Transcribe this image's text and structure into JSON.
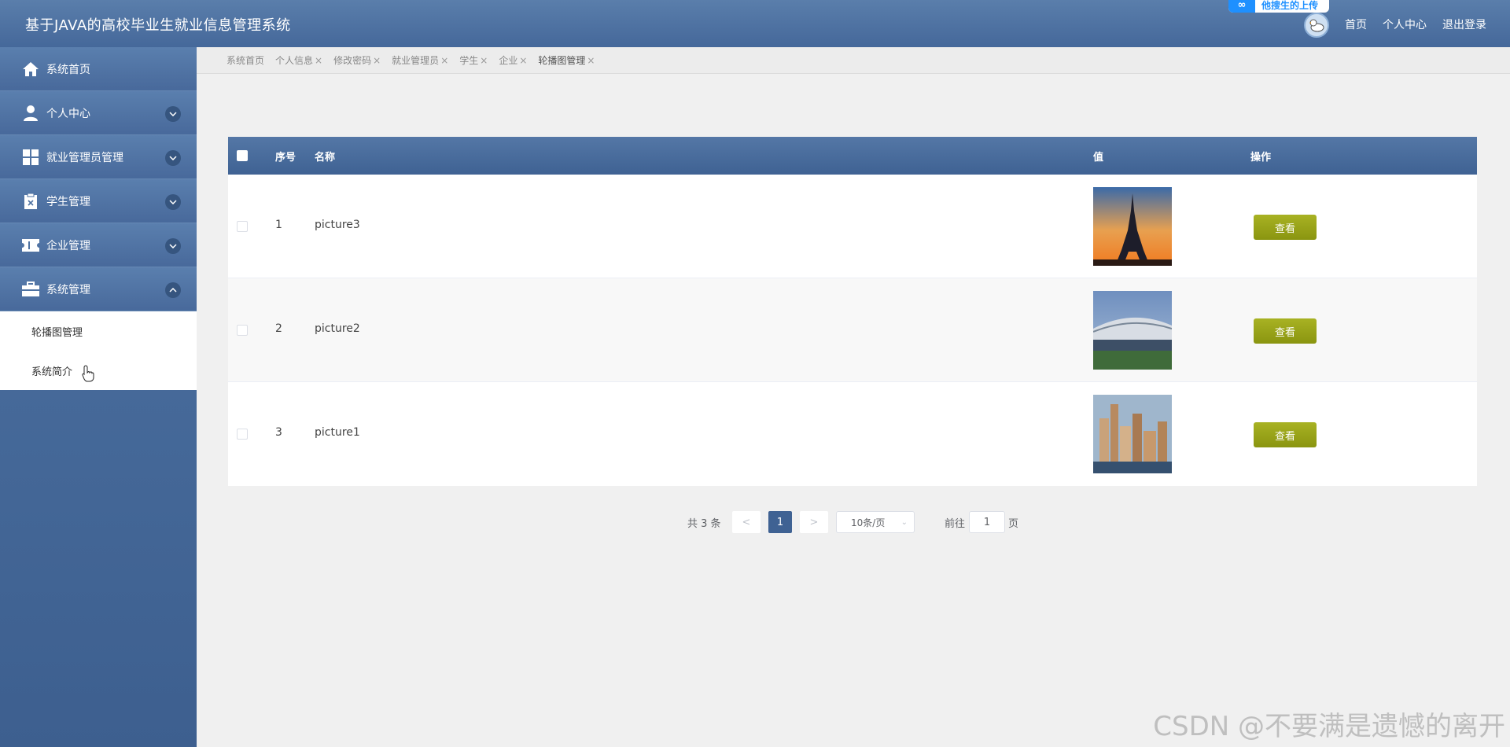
{
  "header": {
    "title": "基于JAVA的高校毕业生就业信息管理系统",
    "upload_badge": "他搜生的上传",
    "nav": [
      "首页",
      "个人中心",
      "退出登录"
    ]
  },
  "sidebar": {
    "items": [
      {
        "label": "系统首页",
        "icon": "home-icon"
      },
      {
        "label": "个人中心",
        "icon": "user-icon"
      },
      {
        "label": "就业管理员管理",
        "icon": "grid-icon"
      },
      {
        "label": "学生管理",
        "icon": "clipboard-icon"
      },
      {
        "label": "企业管理",
        "icon": "ticket-icon"
      },
      {
        "label": "系统管理",
        "icon": "briefcase-icon"
      }
    ],
    "submenu": [
      "轮播图管理",
      "系统简介"
    ]
  },
  "tabs": [
    {
      "label": "系统首页",
      "closable": false
    },
    {
      "label": "个人信息",
      "closable": true
    },
    {
      "label": "修改密码",
      "closable": true
    },
    {
      "label": "就业管理员",
      "closable": true
    },
    {
      "label": "学生",
      "closable": true
    },
    {
      "label": "企业",
      "closable": true
    },
    {
      "label": "轮播图管理",
      "closable": true
    }
  ],
  "table": {
    "headers": {
      "index": "序号",
      "name": "名称",
      "value": "值",
      "action": "操作"
    },
    "rows": [
      {
        "index": "1",
        "name": "picture3",
        "image": "eiffel-tower-sunset",
        "action": "查看"
      },
      {
        "index": "2",
        "name": "picture2",
        "image": "stadium-building",
        "action": "查看"
      },
      {
        "index": "3",
        "name": "picture1",
        "image": "city-skyline",
        "action": "查看"
      }
    ]
  },
  "pagination": {
    "total": "共 3 条",
    "prev": "<",
    "current": "1",
    "next": ">",
    "page_size": "10条/页",
    "goto_label": "前往",
    "goto_value": "1",
    "goto_suffix": "页"
  },
  "watermark": "CSDN @不要满是遗憾的离开",
  "colors": {
    "header": "#4e72a2",
    "accent": "#3f6293",
    "button": "#9aa31a"
  }
}
